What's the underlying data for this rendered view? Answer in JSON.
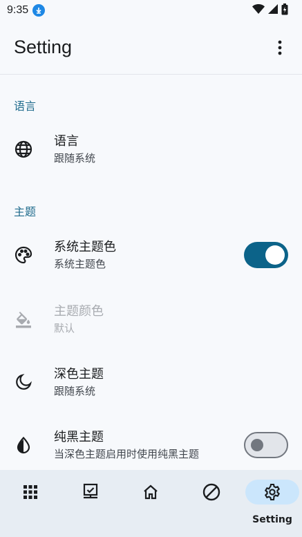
{
  "status_bar": {
    "time": "9:35"
  },
  "app_bar": {
    "title": "Setting"
  },
  "sections": {
    "language": {
      "header": "语言",
      "item": {
        "title": "语言",
        "subtitle": "跟随系统"
      }
    },
    "theme": {
      "header": "主题",
      "system_color": {
        "title": "系统主题色",
        "subtitle": "系统主题色",
        "enabled": true
      },
      "theme_color": {
        "title": "主题颜色",
        "subtitle": "默认"
      },
      "dark_theme": {
        "title": "深色主题",
        "subtitle": "跟随系统"
      },
      "pure_black": {
        "title": "纯黑主题",
        "subtitle": "当深色主题启用时使用纯黑主题",
        "enabled": false
      }
    }
  },
  "bottom_nav": {
    "items": [
      {
        "icon": "apps-grid-icon",
        "label": ""
      },
      {
        "icon": "monitor-check-icon",
        "label": ""
      },
      {
        "icon": "home-icon",
        "label": ""
      },
      {
        "icon": "block-icon",
        "label": ""
      },
      {
        "icon": "settings-gear-icon",
        "label": "Setting",
        "active": true
      }
    ]
  },
  "colors": {
    "accent": "#0c6389",
    "section_header": "#1f6b8c",
    "nav_active_pill": "#cbe6fc",
    "nav_background": "#e7edf3"
  }
}
